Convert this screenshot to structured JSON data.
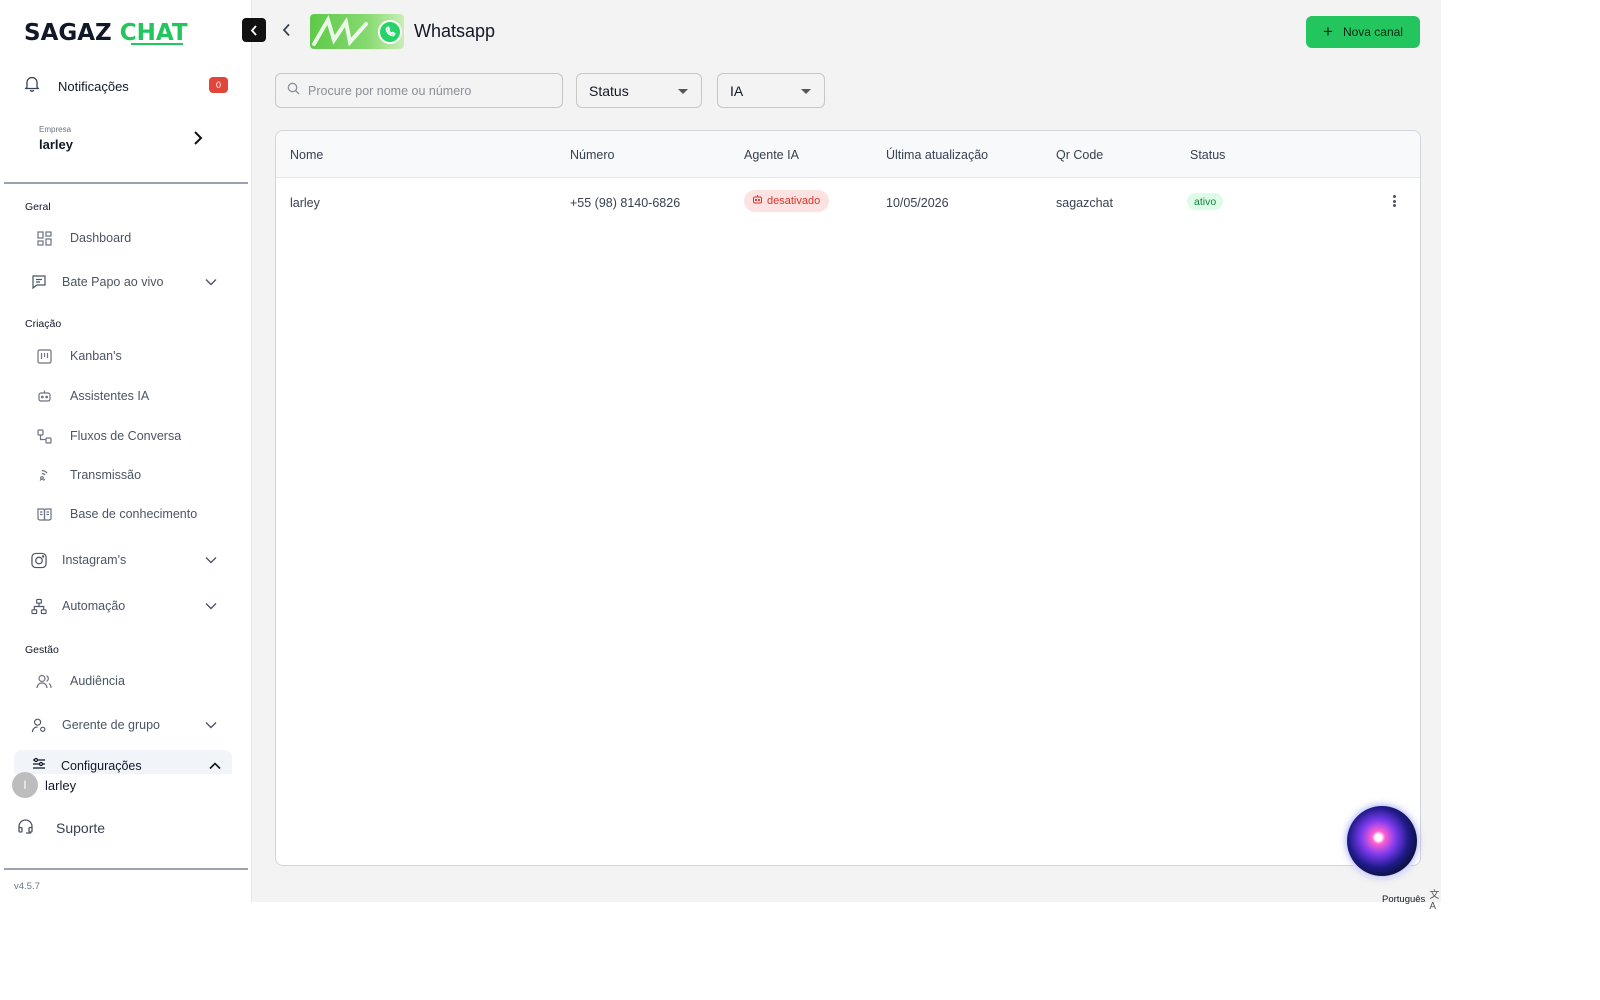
{
  "app": {
    "logo_part1": "SAGAZ ",
    "logo_part2": "CHAT",
    "version": "v4.5.7"
  },
  "sidebar": {
    "notifications": {
      "label": "Notificações",
      "count": "0"
    },
    "company": {
      "label": "Empresa",
      "value": "larley"
    },
    "sections": {
      "geral": "Geral",
      "criacao": "Criação",
      "gestao": "Gestão"
    },
    "items": {
      "dashboard": "Dashboard",
      "bate_papo": "Bate Papo ao vivo",
      "kanban": "Kanban's",
      "assistentes": "Assistentes IA",
      "fluxos": "Fluxos de Conversa",
      "transmissao": "Transmissão",
      "base": "Base de conhecimento",
      "instagram": "Instagram's",
      "automacao": "Automação",
      "audiencia": "Audiência",
      "gerente": "Gerente de grupo",
      "configuracoes": "Configurações"
    },
    "user": {
      "initial": "l",
      "name": "larley"
    },
    "support": "Suporte"
  },
  "header": {
    "title": "Whatsapp",
    "new_button": "Nova canal"
  },
  "filters": {
    "search_placeholder": "Procure por nome ou número",
    "status": "Status",
    "ia": "IA"
  },
  "table": {
    "columns": [
      "Nome",
      "Número",
      "Agente IA",
      "Última atualização",
      "Qr Code",
      "Status"
    ],
    "rows": [
      {
        "nome": "larley",
        "numero": "+55 (98) 8140-6826",
        "agente": "desativado",
        "atualizacao": "10/05/2026",
        "qrcode": "sagazchat",
        "status": "ativo"
      }
    ]
  },
  "footer": {
    "language": "Português"
  },
  "colors": {
    "brand_green": "#22c55e",
    "badge_red": "#e0473a",
    "off_pill_bg": "#fde2e1",
    "on_pill_bg": "#dcfce7"
  }
}
